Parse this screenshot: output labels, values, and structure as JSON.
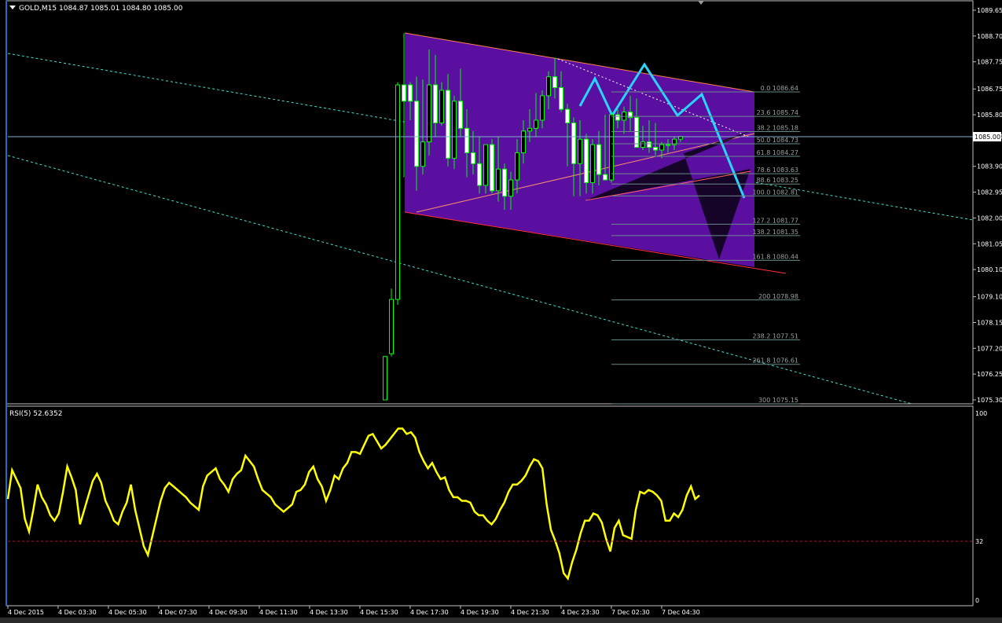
{
  "main_panel": {
    "symbol_label": "GOLD,M15",
    "ohlc_label": "1084.87 1085.01 1084.80 1085.00",
    "current_price_label": "1085.00"
  },
  "rsi_panel": {
    "label": "RSI(5) 52.6352",
    "levels": [
      "100",
      "32",
      "0"
    ]
  },
  "colors": {
    "background": "#000000",
    "grid": "#ffffff",
    "candle_outline": "#00ff00",
    "candle_bull": "#000000",
    "candle_bear": "#ffffff",
    "channel_fill": "#5a0fa0",
    "arrow": "#29d4ff",
    "rsi_line": "#ffff00",
    "rsi_level": "#a01838",
    "trendline": "#40e0d0"
  },
  "chart_data": [
    {
      "type": "candlestick",
      "title": "GOLD,M15",
      "yaxis_ticks": [
        "1089.65",
        "1088.70",
        "1087.75",
        "1086.75",
        "1085.80",
        "1085.00",
        "1083.90",
        "1082.95",
        "1082.00",
        "1081.05",
        "1080.10",
        "1079.10",
        "1078.15",
        "1077.20",
        "1076.25",
        "1075.30"
      ],
      "ylim": [
        1075.3,
        1089.65
      ],
      "x_tick_labels": [
        "4 Dec 2015",
        "4 Dec 03:30",
        "4 Dec 05:30",
        "4 Dec 07:30",
        "4 Dec 09:30",
        "4 Dec 11:30",
        "4 Dec 13:30",
        "4 Dec 15:30",
        "4 Dec 17:30",
        "4 Dec 19:30",
        "4 Dec 21:30",
        "4 Dec 23:30",
        "7 Dec 02:30",
        "7 Dec 04:30"
      ],
      "candles": [
        {
          "i": 0,
          "o": 1075.3,
          "h": 1076.9,
          "l": 1075.3,
          "c": 1076.9
        },
        {
          "i": 1,
          "o": 1077.0,
          "h": 1079.4,
          "l": 1076.9,
          "c": 1079.0
        },
        {
          "i": 2,
          "o": 1079.0,
          "h": 1087.0,
          "l": 1078.8,
          "c": 1086.9
        },
        {
          "i": 3,
          "o": 1086.9,
          "h": 1088.8,
          "l": 1083.5,
          "c": 1086.3
        },
        {
          "i": 4,
          "o": 1086.9,
          "h": 1087.0,
          "l": 1085.6,
          "c": 1086.3
        },
        {
          "i": 5,
          "o": 1086.3,
          "h": 1087.2,
          "l": 1083.0,
          "c": 1083.9
        },
        {
          "i": 6,
          "o": 1083.9,
          "h": 1087.1,
          "l": 1083.6,
          "c": 1084.8
        },
        {
          "i": 7,
          "o": 1084.8,
          "h": 1088.2,
          "l": 1084.3,
          "c": 1086.9
        },
        {
          "i": 8,
          "o": 1086.9,
          "h": 1088.0,
          "l": 1085.0,
          "c": 1085.5
        },
        {
          "i": 9,
          "o": 1085.5,
          "h": 1087.0,
          "l": 1085.4,
          "c": 1086.7
        },
        {
          "i": 10,
          "o": 1086.7,
          "h": 1087.3,
          "l": 1083.9,
          "c": 1084.2
        },
        {
          "i": 11,
          "o": 1084.2,
          "h": 1086.5,
          "l": 1083.8,
          "c": 1086.3
        },
        {
          "i": 12,
          "o": 1086.3,
          "h": 1087.5,
          "l": 1085.0,
          "c": 1085.3
        },
        {
          "i": 13,
          "o": 1085.3,
          "h": 1086.0,
          "l": 1083.5,
          "c": 1084.4
        },
        {
          "i": 14,
          "o": 1084.4,
          "h": 1085.2,
          "l": 1083.6,
          "c": 1084.0
        },
        {
          "i": 15,
          "o": 1084.0,
          "h": 1085.0,
          "l": 1082.9,
          "c": 1083.2
        },
        {
          "i": 16,
          "o": 1083.2,
          "h": 1084.6,
          "l": 1082.9,
          "c": 1084.7
        },
        {
          "i": 17,
          "o": 1084.7,
          "h": 1084.9,
          "l": 1082.9,
          "c": 1083.0
        },
        {
          "i": 18,
          "o": 1083.0,
          "h": 1085.0,
          "l": 1082.6,
          "c": 1083.8
        },
        {
          "i": 19,
          "o": 1083.8,
          "h": 1084.0,
          "l": 1082.3,
          "c": 1082.8
        },
        {
          "i": 20,
          "o": 1082.8,
          "h": 1083.7,
          "l": 1082.3,
          "c": 1083.4
        },
        {
          "i": 21,
          "o": 1083.4,
          "h": 1084.9,
          "l": 1082.9,
          "c": 1084.4
        },
        {
          "i": 22,
          "o": 1084.4,
          "h": 1085.6,
          "l": 1084.0,
          "c": 1085.2
        },
        {
          "i": 23,
          "o": 1085.2,
          "h": 1086.0,
          "l": 1084.8,
          "c": 1085.3
        },
        {
          "i": 24,
          "o": 1085.3,
          "h": 1086.6,
          "l": 1085.0,
          "c": 1085.6
        },
        {
          "i": 25,
          "o": 1085.6,
          "h": 1086.7,
          "l": 1085.3,
          "c": 1086.5
        },
        {
          "i": 26,
          "o": 1086.5,
          "h": 1087.4,
          "l": 1086.0,
          "c": 1087.2
        },
        {
          "i": 27,
          "o": 1087.2,
          "h": 1087.9,
          "l": 1086.4,
          "c": 1086.8
        },
        {
          "i": 28,
          "o": 1086.8,
          "h": 1087.4,
          "l": 1085.9,
          "c": 1086.0
        },
        {
          "i": 29,
          "o": 1086.0,
          "h": 1086.2,
          "l": 1083.9,
          "c": 1085.5
        },
        {
          "i": 30,
          "o": 1085.5,
          "h": 1085.7,
          "l": 1082.8,
          "c": 1084.0
        },
        {
          "i": 31,
          "o": 1084.0,
          "h": 1085.6,
          "l": 1082.8,
          "c": 1084.9
        },
        {
          "i": 32,
          "o": 1084.9,
          "h": 1085.1,
          "l": 1082.9,
          "c": 1083.3
        },
        {
          "i": 33,
          "o": 1083.3,
          "h": 1084.9,
          "l": 1082.9,
          "c": 1084.7
        },
        {
          "i": 34,
          "o": 1084.7,
          "h": 1085.2,
          "l": 1083.2,
          "c": 1083.6
        },
        {
          "i": 35,
          "o": 1083.6,
          "h": 1085.8,
          "l": 1083.4,
          "c": 1083.4
        },
        {
          "i": 36,
          "o": 1083.4,
          "h": 1085.9,
          "l": 1083.3,
          "c": 1085.8
        },
        {
          "i": 37,
          "o": 1085.8,
          "h": 1086.0,
          "l": 1085.3,
          "c": 1085.6
        },
        {
          "i": 38,
          "o": 1085.6,
          "h": 1086.1,
          "l": 1085.1,
          "c": 1085.9
        },
        {
          "i": 39,
          "o": 1085.9,
          "h": 1086.5,
          "l": 1085.2,
          "c": 1085.7
        },
        {
          "i": 40,
          "o": 1085.7,
          "h": 1086.4,
          "l": 1084.6,
          "c": 1084.6
        },
        {
          "i": 41,
          "o": 1084.6,
          "h": 1085.4,
          "l": 1084.5,
          "c": 1084.8
        },
        {
          "i": 42,
          "o": 1084.8,
          "h": 1085.6,
          "l": 1084.4,
          "c": 1084.6
        },
        {
          "i": 43,
          "o": 1084.6,
          "h": 1085.5,
          "l": 1084.3,
          "c": 1084.5
        },
        {
          "i": 44,
          "o": 1084.5,
          "h": 1084.8,
          "l": 1084.2,
          "c": 1084.7
        },
        {
          "i": 45,
          "o": 1084.7,
          "h": 1084.9,
          "l": 1084.4,
          "c": 1084.7
        },
        {
          "i": 46,
          "o": 1084.7,
          "h": 1085.0,
          "l": 1084.5,
          "c": 1084.9
        },
        {
          "i": 47,
          "o": 1084.9,
          "h": 1085.0,
          "l": 1084.8,
          "c": 1085.0
        }
      ],
      "fibonacci_levels": [
        {
          "label": "0.0 1086.64",
          "price": 1086.64
        },
        {
          "label": "23.6 1085.74",
          "price": 1085.74
        },
        {
          "label": "38.2 1085.18",
          "price": 1085.18
        },
        {
          "label": "50.0 1084.73",
          "price": 1084.73
        },
        {
          "label": "61.8 1084.27",
          "price": 1084.27
        },
        {
          "label": "78.6 1083.63",
          "price": 1083.63
        },
        {
          "label": "88.6 1083.25",
          "price": 1083.25
        },
        {
          "label": "100.0 1082.81",
          "price": 1082.81
        },
        {
          "label": "127.2 1081.77",
          "price": 1081.77
        },
        {
          "label": "138.2 1081.35",
          "price": 1081.35
        },
        {
          "label": "161.8 1080.44",
          "price": 1080.44
        },
        {
          "label": "200 1078.98",
          "price": 1078.98
        },
        {
          "label": "238.2 1077.51",
          "price": 1077.51
        },
        {
          "label": "261.8 1076.61",
          "price": 1076.61
        },
        {
          "label": "300 1075.15",
          "price": 1075.15
        }
      ]
    },
    {
      "type": "line",
      "title": "RSI(5) 52.6352",
      "ylim": [
        0,
        100
      ],
      "levels": [
        32
      ],
      "values": [
        56,
        72,
        67,
        62,
        45,
        38,
        50,
        64,
        57,
        53,
        47,
        44,
        48,
        60,
        74,
        68,
        61,
        42,
        50,
        58,
        66,
        70,
        65,
        55,
        50,
        44,
        42,
        49,
        54,
        64,
        50,
        40,
        30,
        25,
        35,
        45,
        55,
        62,
        65,
        63,
        61,
        59,
        57,
        54,
        52,
        50,
        63,
        69,
        71,
        73,
        67,
        64,
        60,
        67,
        70,
        72,
        80,
        77,
        74,
        67,
        61,
        59,
        57,
        53,
        51,
        49,
        51,
        53,
        60,
        61,
        64,
        71,
        74,
        67,
        63,
        55,
        61,
        69,
        67,
        73,
        76,
        82,
        82,
        81,
        86,
        91,
        92,
        88,
        84,
        86,
        89,
        92,
        95,
        95,
        92,
        93,
        90,
        82,
        77,
        73,
        76,
        71,
        67,
        68,
        61,
        57,
        57,
        55,
        55,
        54,
        49,
        47,
        47,
        44,
        42,
        45,
        50,
        54,
        60,
        64,
        64,
        66,
        69,
        74,
        78,
        77,
        73,
        53,
        39,
        33,
        26,
        15,
        12,
        21,
        28,
        37,
        44,
        44,
        48,
        47,
        43,
        34,
        27,
        40,
        44,
        36,
        35,
        34,
        50,
        60,
        59,
        61,
        60,
        58,
        55,
        44,
        44,
        48,
        46,
        50,
        58,
        63,
        56,
        58
      ]
    }
  ]
}
